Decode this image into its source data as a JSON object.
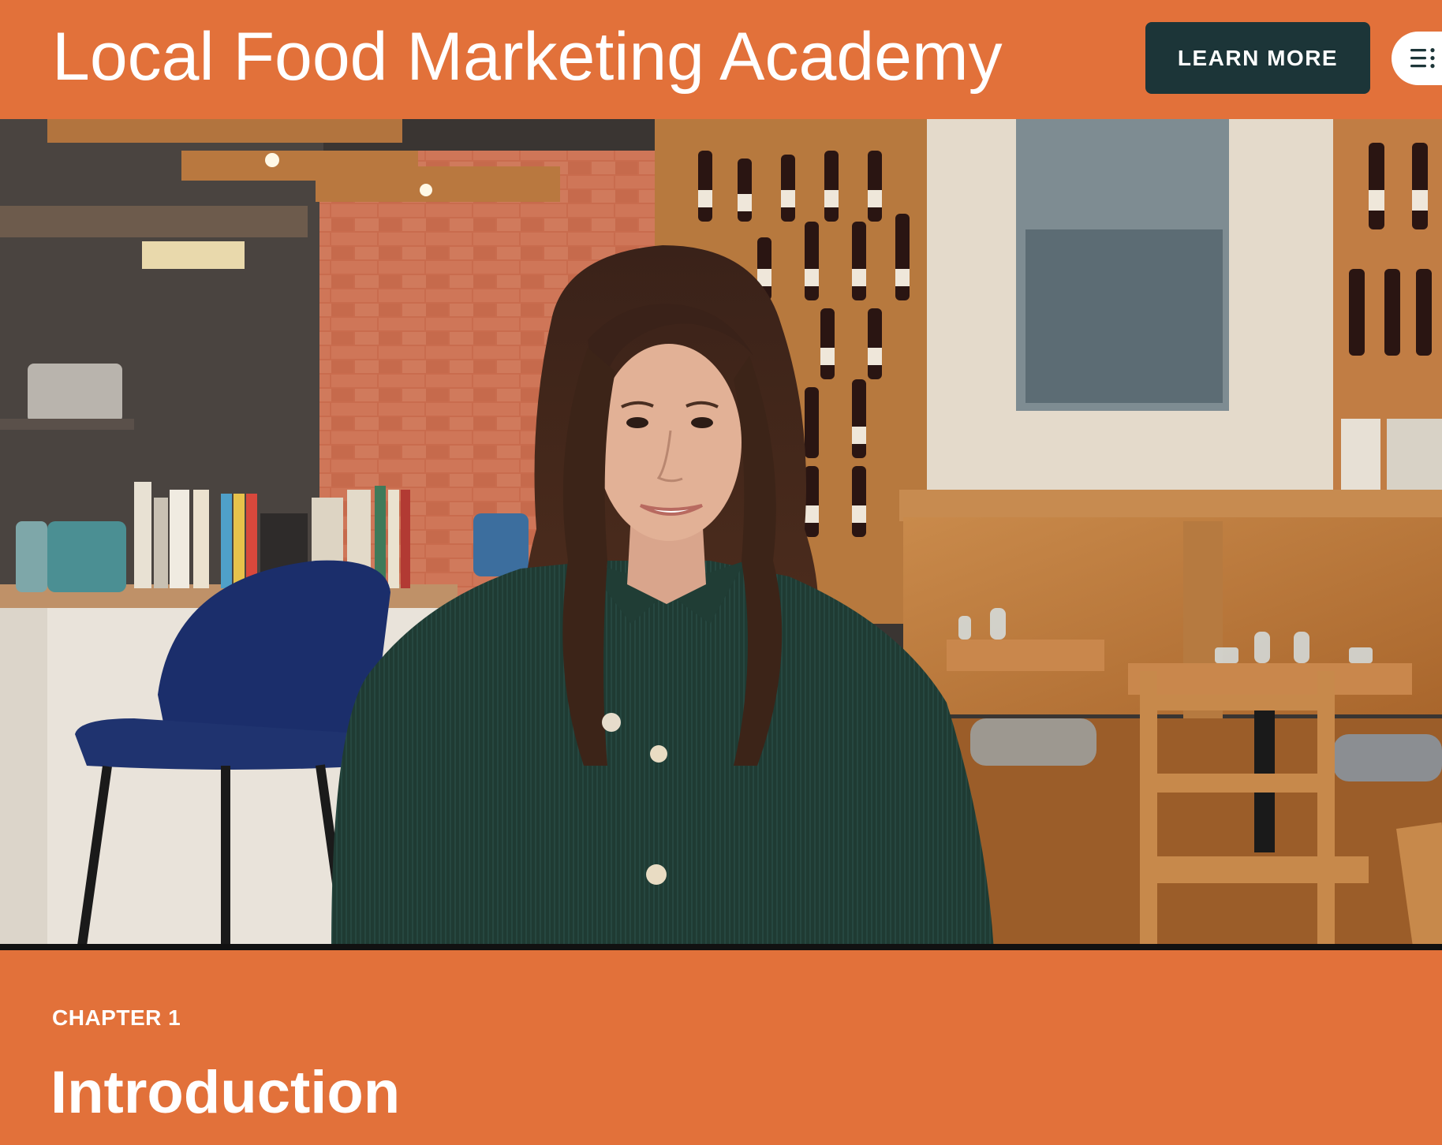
{
  "header": {
    "title": "Local Food Marketing Academy",
    "cta_label": "LEARN MORE",
    "menu_icon": "menu-list-icon"
  },
  "video": {
    "description_icon": "video-frame",
    "colors": {
      "wall_brick": "#C9684A",
      "shelf_wood": "#B8733A",
      "jacket": "#1F3B33",
      "chair": "#1B2E6B"
    }
  },
  "chapter": {
    "eyebrow": "CHAPTER 1",
    "title": "Introduction"
  },
  "colors": {
    "accent": "#E2713A",
    "button_dark": "#1C3538",
    "text_light": "#ffffff"
  }
}
